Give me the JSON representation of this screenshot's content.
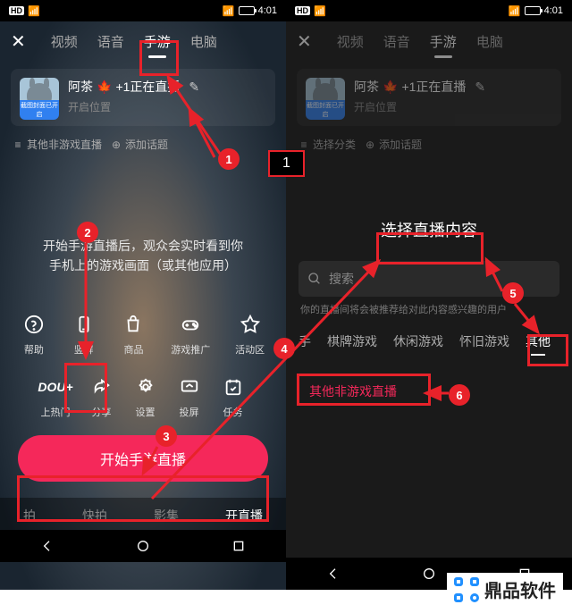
{
  "status": {
    "hd": "HD",
    "time": "4:01"
  },
  "tabs": {
    "video": "视频",
    "voice": "语音",
    "mobile_game": "手游",
    "pc": "电脑"
  },
  "stream": {
    "title_name": "阿茶",
    "title_suffix": "+1正在直播",
    "subtitle": "开启位置",
    "avatar_badge": "截图封面已开启"
  },
  "chips_left": {
    "cat": "其他非游戏直播",
    "topic": "添加话题"
  },
  "chips_right": {
    "cat": "选择分类",
    "topic": "添加话题"
  },
  "desc_line1": "开始手游直播后，观众会实时看到你",
  "desc_line2": "手机上的游戏画面（或其他应用）",
  "icons1": {
    "help": "帮助",
    "portrait": "竖屏",
    "shop": "商品",
    "game_rec": "游戏推广",
    "activity": "活动区"
  },
  "icons2": {
    "hot": "上热门",
    "share": "分享",
    "settings": "设置",
    "cast": "投屏",
    "task": "任务",
    "dou": "DOU+"
  },
  "start_button": "开始手游直播",
  "bottom": {
    "shoot": "拍",
    "quick": "快拍",
    "movie": "影集",
    "live": "开直播"
  },
  "right": {
    "title": "选择直播内容",
    "search": "搜索",
    "hint": "你的直播间将会被推荐给对此内容感兴趣的用户",
    "cats": {
      "partial": "手",
      "chess": "棋牌游戏",
      "casual": "休闲游戏",
      "retro": "怀旧游戏",
      "other": "其他"
    },
    "other_item": "其他非游戏直播"
  },
  "annot_1": "1",
  "markers": {
    "1": "1",
    "2": "2",
    "3": "3",
    "4": "4",
    "5": "5",
    "6": "6"
  },
  "watermark": "鼎品软件"
}
